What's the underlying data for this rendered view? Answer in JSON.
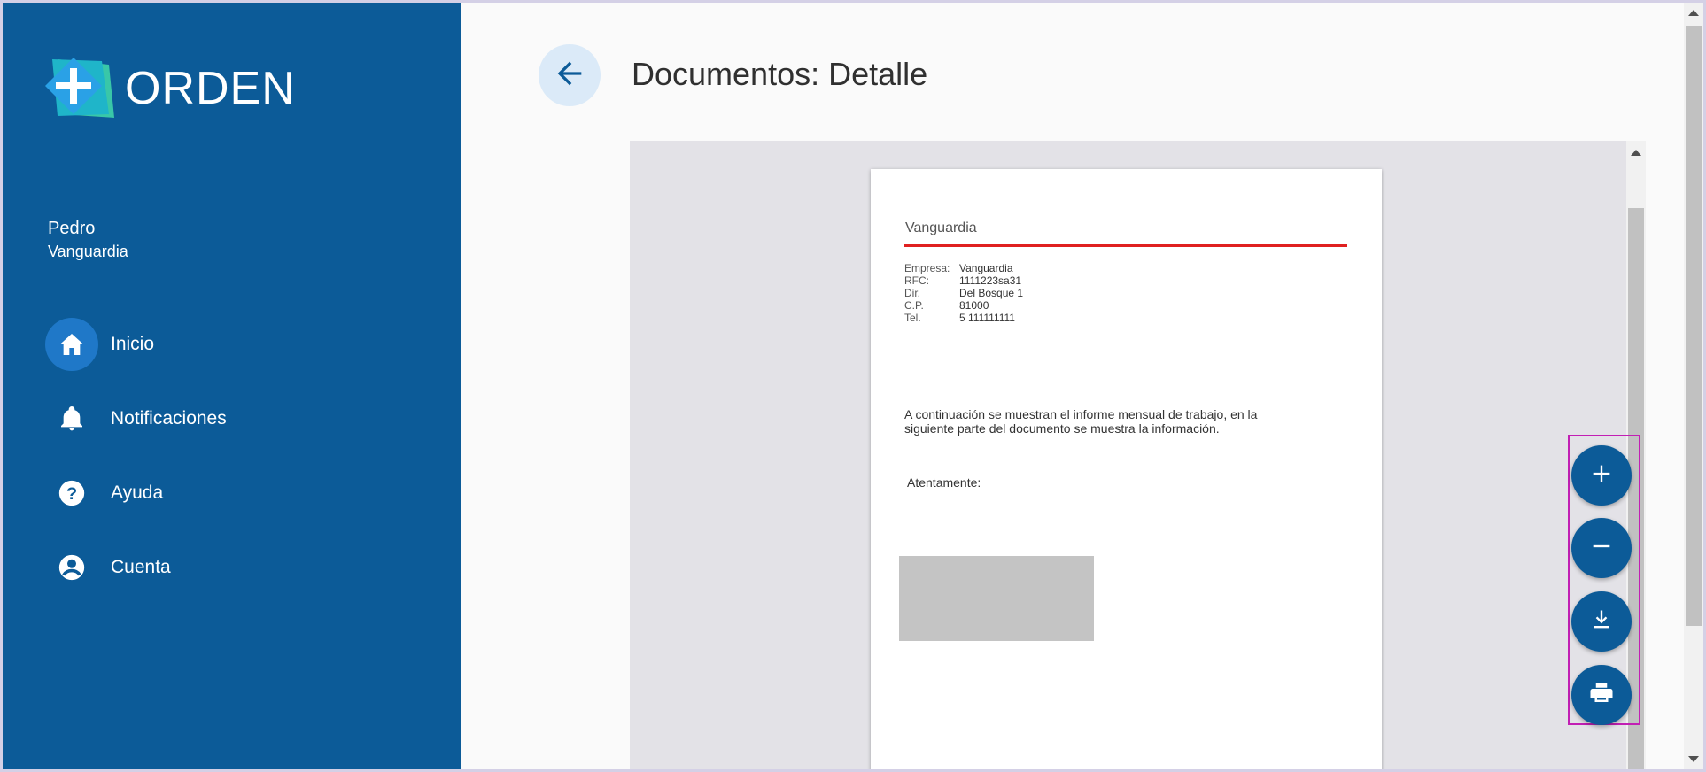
{
  "brand": {
    "name": "ORDEN",
    "colors": {
      "sidebar": "#0c5b98",
      "accent": "#1f78c8",
      "rule": "#e02020"
    }
  },
  "user": {
    "first_name": "Pedro",
    "company": "Vanguardia"
  },
  "nav": {
    "items": [
      {
        "label": "Inicio",
        "icon": "home-icon",
        "active": true
      },
      {
        "label": "Notificaciones",
        "icon": "bell-icon",
        "active": false
      },
      {
        "label": "Ayuda",
        "icon": "help-icon",
        "active": false
      },
      {
        "label": "Cuenta",
        "icon": "account-icon",
        "active": false
      }
    ]
  },
  "header": {
    "title": "Documentos: Detalle"
  },
  "document": {
    "company_header": "Vanguardia",
    "fields": [
      {
        "key": "Empresa:",
        "value": "Vanguardia"
      },
      {
        "key": "RFC:",
        "value": "1111223sa31"
      },
      {
        "key": "Dir.",
        "value": "Del Bosque 1"
      },
      {
        "key": "C.P.",
        "value": "81000"
      },
      {
        "key": "Tel.",
        "value": "5 111111111"
      }
    ],
    "body": "A continuación se muestran el informe mensual de trabajo, en la siguiente parte del documento se muestra la información.",
    "signature": "Atentamente:"
  },
  "fabs": [
    {
      "icon": "zoom-in-icon"
    },
    {
      "icon": "zoom-out-icon"
    },
    {
      "icon": "download-icon"
    },
    {
      "icon": "print-icon"
    }
  ]
}
